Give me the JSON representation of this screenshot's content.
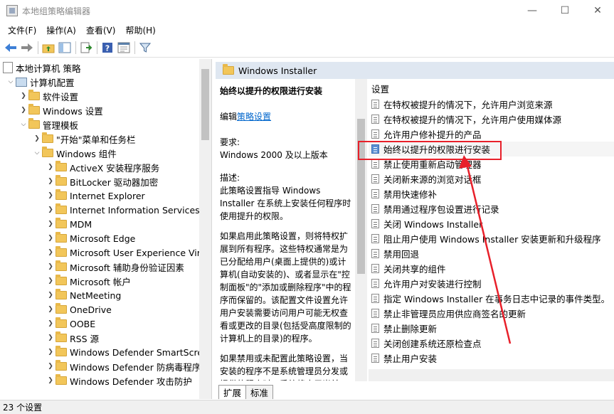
{
  "window": {
    "title": "本地组策略编辑器",
    "minimize": "—",
    "maximize": "☐",
    "close": "✕"
  },
  "menu": {
    "file": "文件(F)",
    "action": "操作(A)",
    "view": "查看(V)",
    "help": "帮助(H)"
  },
  "tree": {
    "root": "本地计算机 策略",
    "computer_config": "计算机配置",
    "software_settings": "软件设置",
    "windows_settings": "Windows 设置",
    "admin_templates": "管理模板",
    "start_menu": "\"开始\"菜单和任务栏",
    "windows_components": "Windows 组件",
    "children": [
      "ActiveX 安装程序服务",
      "BitLocker 驱动器加密",
      "Internet Explorer",
      "Internet Information Services",
      "MDM",
      "Microsoft Edge",
      "Microsoft User Experience Virt",
      "Microsoft 辅助身份验证因素",
      "Microsoft 帐户",
      "NetMeeting",
      "OneDrive",
      "OOBE",
      "RSS 源",
      "Windows Defender SmartScre",
      "Windows Defender 防病毒程序",
      "Windows Defender 攻击防护"
    ]
  },
  "pane": {
    "header": "Windows Installer",
    "desc": {
      "title": "始终以提升的权限进行安装",
      "edit_prefix": "编辑",
      "edit_link": "策略设置",
      "req_label": "要求:",
      "req_value": "Windows 2000 及以上版本",
      "desc_label": "描述:",
      "p1": "此策略设置指导 Windows Installer 在系统上安装任何程序时使用提升的权限。",
      "p2": "如果启用此策略设置，则将特权扩展到所有程序。这些特权通常是为已分配给用户(桌面上提供的)或计算机(自动安装的)、或者显示在\"控制面板\"的\"添加或删除程序\"中的程序而保留的。该配置文件设置允许用户安装需要访问用户可能无权查看或更改的目录(包括受高度限制的计算机上的目录)的程序。",
      "p3": "如果禁用或未配置此策略设置，当安装的程序不是系统管理员分发或提供的程序时，系统将应用当前"
    },
    "list_header": "设置",
    "settings": [
      "在特权被提升的情况下，允许用户浏览来源",
      "在特权被提升的情况下，允许用户使用媒体源",
      "允许用户修补提升的产品",
      "始终以提升的权限进行安装",
      "禁止使用重新启动管理器",
      "关闭新来源的浏览对话框",
      "禁用快速修补",
      "禁用通过程序包设置进行记录",
      "关闭 Windows Installer",
      "阻止用户使用 Windows Installer 安装更新和升级程序",
      "禁用回退",
      "关闭共享的组件",
      "允许用户对安装进行控制",
      "指定 Windows Installer 在事务日志中记录的事件类型。",
      "禁止非管理员应用供应商签名的更新",
      "禁止删除更新",
      "关闭创建系统还原检查点",
      "禁止用户安装"
    ],
    "tabs": {
      "extended": "扩展",
      "standard": "标准"
    }
  },
  "status": {
    "count": "23 个设置"
  },
  "colors": {
    "highlight": "#e8202a",
    "arrow": "#e8202a",
    "link": "#0066cc"
  }
}
